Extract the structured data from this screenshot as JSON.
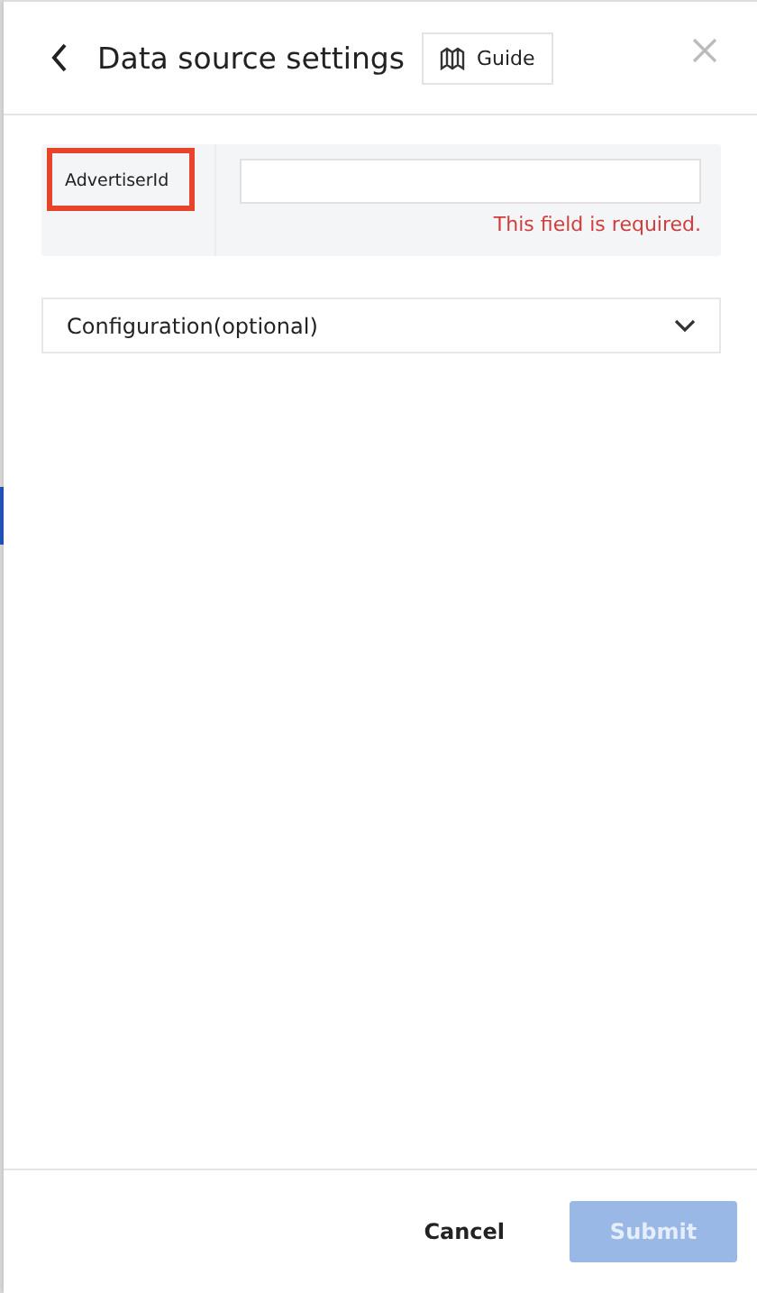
{
  "header": {
    "title": "Data source settings",
    "guide_button": "Guide"
  },
  "fields": [
    {
      "label": "AdvertiserId",
      "highlighted": true,
      "error": "This field is required."
    }
  ],
  "sections": [
    {
      "title": "Configuration(optional)",
      "expanded": false
    }
  ],
  "footer": {
    "cancel": "Cancel",
    "submit": {
      "label": "Submit",
      "disabled": true
    }
  }
}
